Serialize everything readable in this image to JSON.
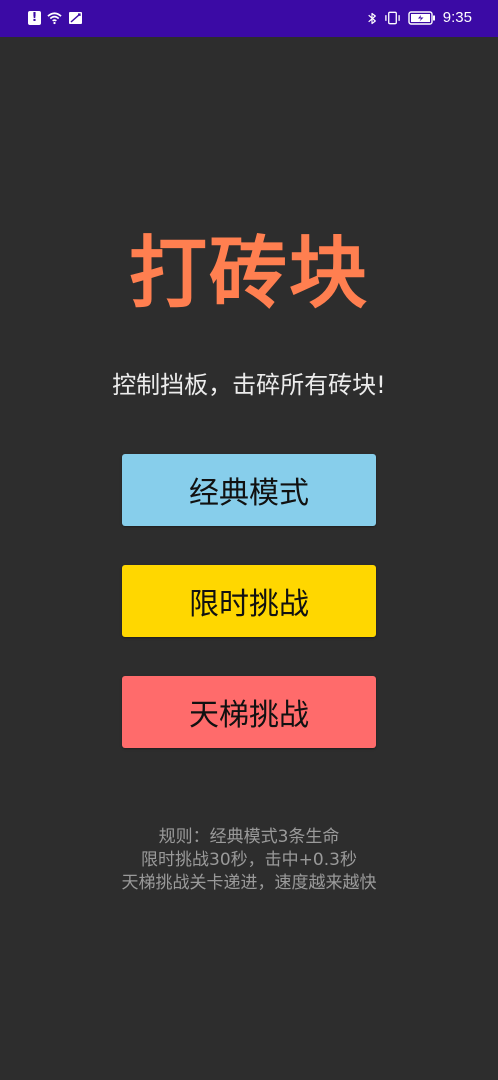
{
  "status_bar": {
    "time": "9:35",
    "background": "#3b0aa5"
  },
  "game": {
    "title": "打砖块",
    "title_color": "#ff7f50",
    "subtitle": "控制挡板，击碎所有砖块!"
  },
  "modes": [
    {
      "label": "经典模式",
      "color": "#87ceeb"
    },
    {
      "label": "限时挑战",
      "color": "#ffd700"
    },
    {
      "label": "天梯挑战",
      "color": "#ff6b6b"
    }
  ],
  "rules": {
    "line1": "规则：经典模式3条生命",
    "line2": "限时挑战30秒，击中+0.3秒",
    "line3": "天梯挑战关卡递进，速度越来越快"
  }
}
